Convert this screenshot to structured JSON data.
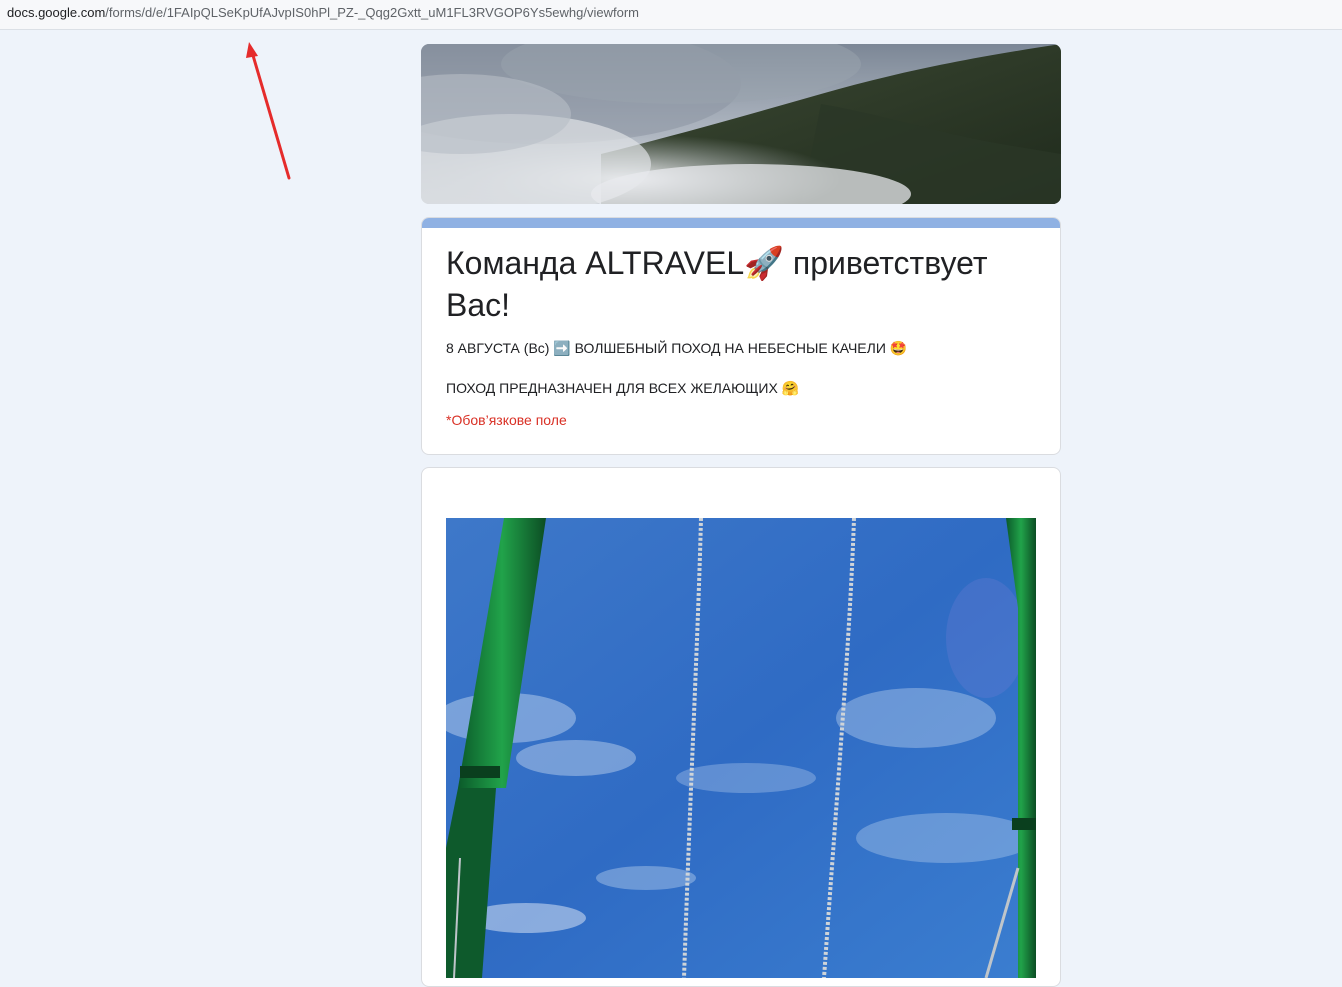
{
  "browser": {
    "url_host": "docs.google.com",
    "url_path": "/forms/d/e/1FAIpQLSeKpUfAJvpIS0hPl_PZ-_Qqg2Gxtt_uM1FL3RVGOP6Ys5ewhg/viewform"
  },
  "form": {
    "title": "Команда ALTRAVEL🚀 приветствует Вас!",
    "description_line_1": "8 АВГУСТА (Вс) ➡️ ВОЛШЕБНЫЙ ПОХОД НА НЕБЕСНЫЕ КАЧЕЛИ 🤩",
    "description_line_2": "ПОХОД ПРЕДНАЗНАЧЕН ДЛЯ ВСЕХ ЖЕЛАЮЩИХ 🤗",
    "required_note": "*Обов’язкове поле"
  },
  "colors": {
    "page_background": "#eef3fa",
    "card_accent": "#8fb1e3",
    "required_red": "#d93025",
    "annotation_arrow": "#e52b2b"
  }
}
